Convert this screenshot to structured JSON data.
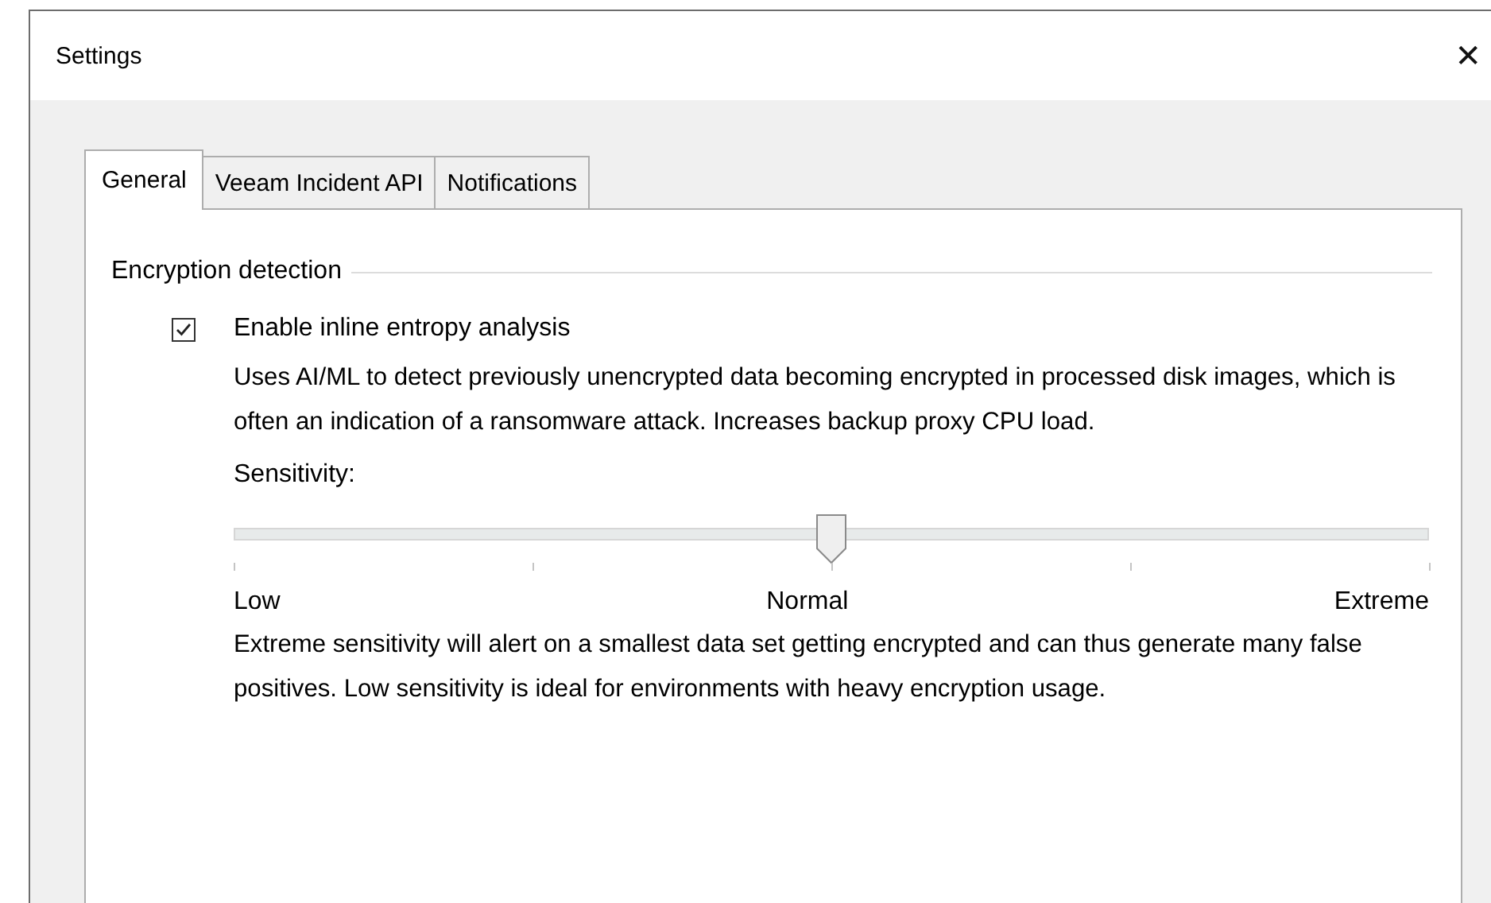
{
  "window": {
    "title": "Settings",
    "close": "✕"
  },
  "tabs": [
    {
      "label": "General",
      "selected": true
    },
    {
      "label": "Veeam Incident API",
      "selected": false
    },
    {
      "label": "Notifications",
      "selected": false
    }
  ],
  "group": {
    "title": "Encryption detection",
    "checkbox": {
      "label": "Enable inline entropy analysis",
      "checked": true
    },
    "description": "Uses AI/ML to detect previously unencrypted data becoming encrypted in processed disk images, which is often an indication of a ransomware attack. Increases backup proxy CPU load.",
    "slider": {
      "label": "Sensitivity:",
      "level": 0.5,
      "labels": [
        "Low",
        "Normal",
        "Extreme"
      ]
    },
    "note": "Extreme sensitivity will alert on a smallest data set getting encrypted and can thus generate many false positives. Low sensitivity is ideal for environments with heavy encryption usage."
  }
}
